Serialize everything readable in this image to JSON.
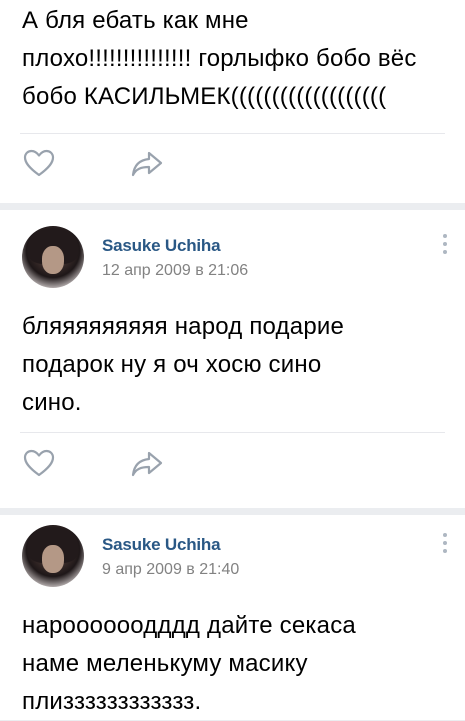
{
  "posts": [
    {
      "text": "А бля ебать как мне\nплохо!!!!!!!!!!!!!!! горлыфко бобо вёс\nбобо КАСИЛЬМЕК((((((((((((((((((("
    },
    {
      "author": "Sasuke Uchiha",
      "date": "12 апр 2009 в 21:06",
      "text": "бляяяяяяяяя народ подарие\nподарок ну я оч хосю сино\nсино."
    },
    {
      "author": "Sasuke Uchiha",
      "date": "9 апр 2009 в 21:40",
      "text": "нароооооодддд дайте секаса\nнаме меленькуму масику\nплизззззззззззз."
    }
  ],
  "icons": {
    "like": "heart-icon",
    "share": "share-arrow-icon",
    "more": "more-vertical-icon"
  },
  "colors": {
    "background": "#ebedf0",
    "card": "#ffffff",
    "author": "#2a5885",
    "date": "#828282",
    "icon": "#99a2ad"
  }
}
